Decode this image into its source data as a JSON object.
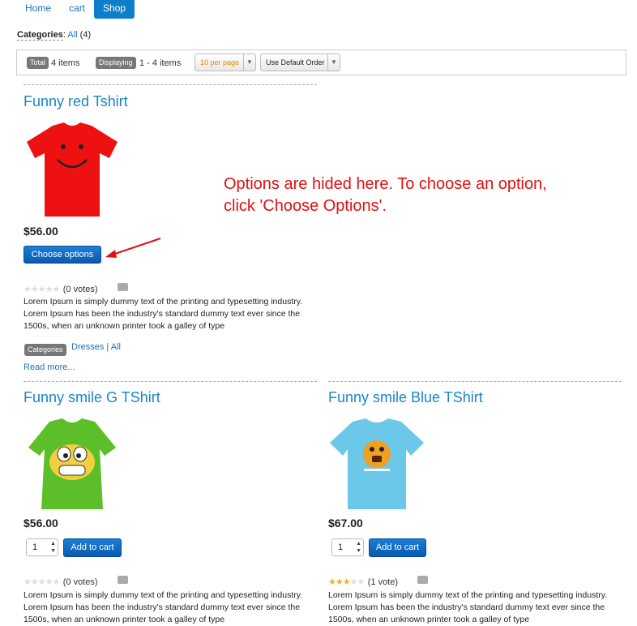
{
  "nav": {
    "items": [
      {
        "label": "Home",
        "active": false
      },
      {
        "label": "cart",
        "active": false
      },
      {
        "label": "Shop",
        "active": true
      }
    ]
  },
  "categories_bar": {
    "label": "Categories",
    "link": "All",
    "count": "(4)"
  },
  "filter": {
    "total_badge": "Total",
    "total_value": "4 items",
    "displaying_badge": "Displaying",
    "displaying_value": "1 - 4 items",
    "per_page": "10 per page",
    "order": "Use Default Order"
  },
  "annotation": "Options are hided here. To choose an option, click 'Choose Options'.",
  "products": [
    {
      "title": "Funny red Tshirt",
      "image": "red-smiley-tshirt",
      "price": "$56.00",
      "action": "Choose options",
      "rating": 0,
      "votes": "(0 votes)",
      "description": "Lorem Ipsum is simply dummy text of the printing and typesetting industry. Lorem Ipsum has been the industry's standard dummy text ever since the 1500s, when an unknown printer took a galley of type",
      "categories_badge": "Categories",
      "categories_links": "Dresses | All",
      "read_more": "Read more..."
    },
    {
      "title": "Funny smile G TShirt",
      "image": "green-grin-tshirt",
      "price": "$56.00",
      "qty": "1",
      "action": "Add to cart",
      "rating": 0,
      "votes": "(0 votes)",
      "description": "Lorem Ipsum is simply dummy text of the printing and typesetting industry. Lorem Ipsum has been the industry's standard dummy text ever since the 1500s, when an unknown printer took a galley of type"
    },
    {
      "title": "Funny smile Blue TShirt",
      "image": "blue-emoji-tshirt",
      "price": "$67.00",
      "qty": "1",
      "action": "Add to cart",
      "rating": 3,
      "votes": "(1 vote)",
      "description": "Lorem Ipsum is simply dummy text of the printing and typesetting industry. Lorem Ipsum has been the industry's standard dummy text ever since the 1500s, when an unknown printer took a galley of type"
    }
  ],
  "colors": {
    "link": "#1a86c8",
    "button": "#0a5ab0",
    "annotation": "#e01010",
    "star": "#f2b01e"
  }
}
